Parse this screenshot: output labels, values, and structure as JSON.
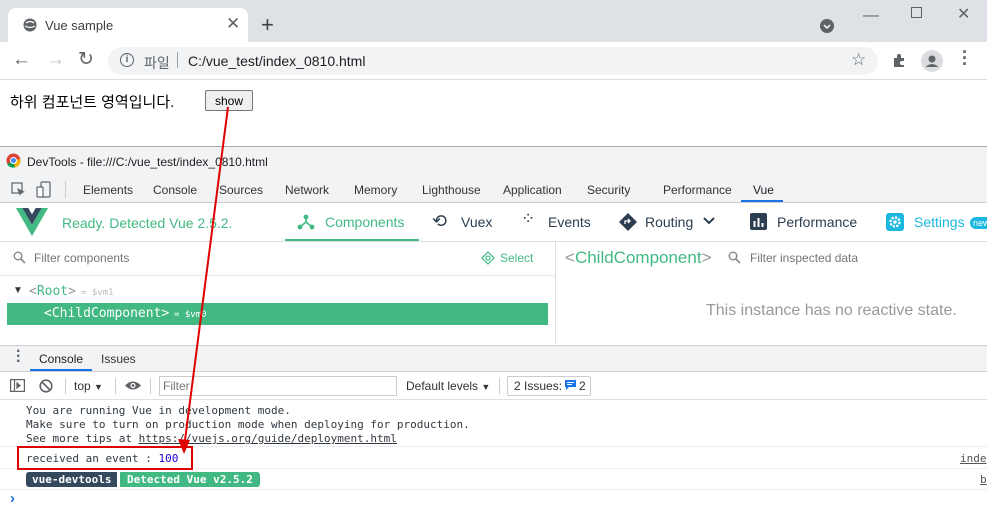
{
  "window": {
    "tab_title": "Vue sample",
    "address_scheme": "파일",
    "address_url": "C:/vue_test/index_0810.html"
  },
  "page": {
    "text": "하위 컴포넌트 영역입니다.",
    "button_label": "show"
  },
  "devtools": {
    "title": "DevTools - file:///C:/vue_test/index_0810.html",
    "tabs": [
      "Elements",
      "Console",
      "Sources",
      "Network",
      "Memory",
      "Lighthouse",
      "Application",
      "Security",
      "Performance",
      "Vue"
    ],
    "active_tab": "Vue"
  },
  "vue": {
    "status": "Ready. Detected Vue 2.5.2.",
    "nav": {
      "components": "Components",
      "vuex": "Vuex",
      "events": "Events",
      "routing": "Routing",
      "performance": "Performance",
      "settings": "Settings",
      "badge": "new"
    },
    "filter_components_placeholder": "Filter components",
    "select_label": "Select",
    "tree": {
      "root": "Root",
      "root_ref": "= $vm1",
      "child": "ChildComponent",
      "child_ref": "= $vm0"
    },
    "inspected_name": "ChildComponent",
    "filter_inspected_placeholder": "Filter inspected data",
    "no_state": "This instance has no reactive state."
  },
  "console": {
    "tabs": [
      "Console",
      "Issues"
    ],
    "context": "top",
    "filter_placeholder": "Filter",
    "levels": "Default levels",
    "issues_label": "2 Issues:",
    "issues_count": "2",
    "messages": {
      "line1": "You are running Vue in development mode.",
      "line2": "Make sure to turn on production mode when deploying for production.",
      "line3_prefix": "See more tips at ",
      "line3_link": "https://vuejs.org/guide/deployment.html",
      "event_text": "received an event : ",
      "event_value": "100",
      "event_source": "inde",
      "badge_left": "vue-devtools",
      "badge_right": "Detected Vue v2.5.2",
      "badge_source": "b"
    },
    "prompt": "›"
  },
  "colors": {
    "vue_green": "#42b983",
    "annotation_red": "#e00000",
    "link": "#1a73e8"
  }
}
